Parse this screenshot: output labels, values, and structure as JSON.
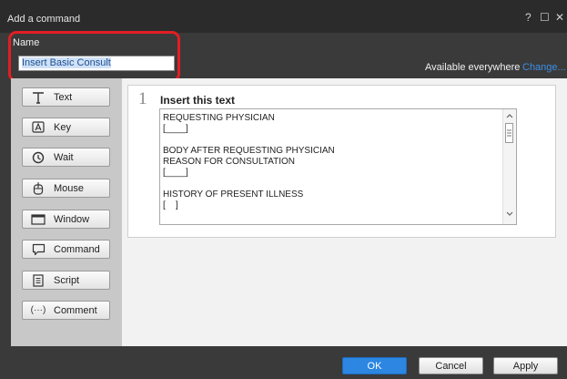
{
  "window": {
    "title": "Add a command",
    "help": "?",
    "maximize": "☐",
    "close": "✕"
  },
  "name": {
    "label": "Name",
    "value": "Insert Basic Consult"
  },
  "availability": {
    "text": "Available everywhere",
    "link": "Change..."
  },
  "sidebar": {
    "items": [
      {
        "label": "Text",
        "icon": "text-icon"
      },
      {
        "label": "Key",
        "icon": "key-icon"
      },
      {
        "label": "Wait",
        "icon": "clock-icon"
      },
      {
        "label": "Mouse",
        "icon": "mouse-icon"
      },
      {
        "label": "Window",
        "icon": "window-icon"
      },
      {
        "label": "Command",
        "icon": "speech-bubble-icon"
      },
      {
        "label": "Script",
        "icon": "script-icon"
      },
      {
        "label": "Comment",
        "icon": "ellipsis-parens-icon"
      }
    ]
  },
  "step": {
    "number": "1",
    "title": "Insert this text",
    "text": "REQUESTING PHYSICIAN\n[____]\n\nBODY AFTER REQUESTING PHYSICIAN\nREASON FOR CONSULTATION\n[____]\n\nHISTORY OF PRESENT ILLNESS\n[    ]"
  },
  "footer": {
    "ok": "OK",
    "cancel": "Cancel",
    "apply": "Apply"
  },
  "colors": {
    "accent": "#2c86e2",
    "highlight_ring": "#e31e24",
    "link": "#3a8ee6"
  }
}
